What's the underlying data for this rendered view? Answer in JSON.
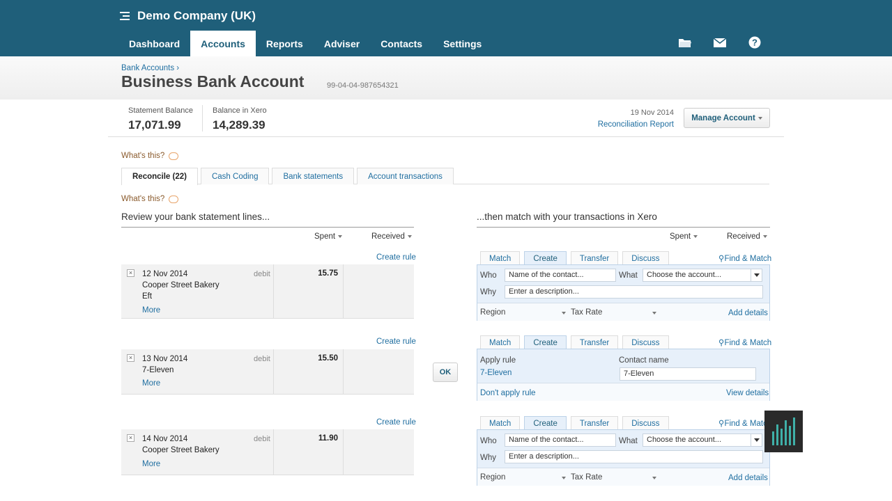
{
  "org": {
    "name": "Demo Company (UK)"
  },
  "nav": {
    "items": [
      "Dashboard",
      "Accounts",
      "Reports",
      "Adviser",
      "Contacts",
      "Settings"
    ],
    "active": "Accounts"
  },
  "toolbar_icons": [
    "folder-icon",
    "mail-icon",
    "help-icon"
  ],
  "breadcrumb": {
    "label": "Bank Accounts",
    "sep": "›"
  },
  "page": {
    "title": "Business Bank Account",
    "account_number": "99-04-04-987654321"
  },
  "balances": {
    "statement_label": "Statement Balance",
    "statement_value": "17,071.99",
    "xero_label": "Balance in Xero",
    "xero_value": "14,289.39",
    "date": "19 Nov 2014",
    "report_link": "Reconciliation Report",
    "manage_label": "Manage Account"
  },
  "help": {
    "whats_this": "What's this?"
  },
  "tabs": [
    "Reconcile (22)",
    "Cash Coding",
    "Bank statements",
    "Account transactions"
  ],
  "left": {
    "heading": "Review your bank statement lines...",
    "spent": "Spent",
    "received": "Received",
    "create_rule": "Create rule",
    "more": "More"
  },
  "right": {
    "heading": "...then match with your transactions in Xero",
    "spent": "Spent",
    "received": "Received",
    "find_match": "Find & Match",
    "tabs": [
      "Match",
      "Create",
      "Transfer",
      "Discuss"
    ]
  },
  "lines": [
    {
      "date": "12 Nov 2014",
      "payee": "Cooper Street Bakery",
      "ref": "Eft",
      "type": "debit",
      "amount": "15.75"
    },
    {
      "date": "13 Nov 2014",
      "payee": "7-Eleven",
      "ref": "",
      "type": "debit",
      "amount": "15.50"
    },
    {
      "date": "14 Nov 2014",
      "payee": "Cooper Street Bakery",
      "ref": "",
      "type": "debit",
      "amount": "11.90"
    }
  ],
  "ok_label": "OK",
  "create_form": {
    "who": "Who",
    "what": "What",
    "why": "Why",
    "who_placeholder": "Name of the contact...",
    "what_value": "Choose the account...",
    "why_placeholder": "Enter a description...",
    "region": "Region",
    "tax_rate": "Tax Rate",
    "add_details": "Add details"
  },
  "rule_form": {
    "apply_rule_label": "Apply rule",
    "rule_name": "7-Eleven",
    "contact_label": "Contact name",
    "contact_value": "7-Eleven",
    "dont_apply": "Don't apply rule",
    "view_details": "View details"
  },
  "colors": {
    "header": "#1f5f7a",
    "link": "#1f6ea0",
    "panel": "#e7f0fa"
  }
}
